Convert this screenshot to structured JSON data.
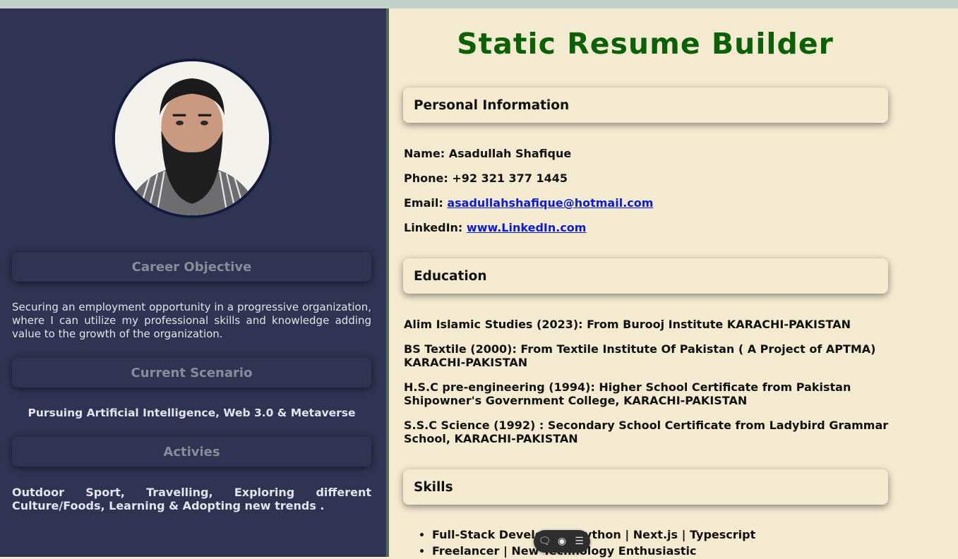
{
  "sidebar": {
    "career_heading": "Career Objective",
    "career_text": "Securing an employment opportunity in a progressive organization, where I can utilize my professional skills and knowledge adding value to the growth of the organization.",
    "scenario_heading": "Current Scenario",
    "scenario_text": "Pursuing Artificial Intelligence, Web 3.0 & Metaverse",
    "activities_heading": "Activies",
    "activities_text": "Outdoor Sport, Travelling, Exploring different Culture/Foods, Learning & Adopting new trends ."
  },
  "main": {
    "title": "Static Resume Builder",
    "personal": {
      "heading": "Personal Information",
      "name_label": "Name:",
      "name_value": "Asadullah Shafique",
      "phone_label": "Phone:",
      "phone_value": "+92 321 377 1445",
      "email_label": "Email:",
      "email_value": "asadullahshafique@hotmail.com",
      "linkedin_label": "LinkedIn:",
      "linkedin_value": "www.LinkedIn.com"
    },
    "education": {
      "heading": "Education",
      "items": [
        "Alim Islamic Studies (2023): From Burooj Institute KARACHI-PAKISTAN",
        "BS Textile (2000): From Textile Institute Of Pakistan ( A Project of APTMA) KARACHI-PAKISTAN",
        "H.S.C pre-engineering (1994): Higher School Certificate from Pakistan Shipowner's Government College, KARACHI-PAKISTAN",
        "S.S.C Science (1992) : Secondary School Certificate from Ladybird Grammar School, KARACHI-PAKISTAN"
      ]
    },
    "skills": {
      "heading": "Skills",
      "items": [
        "Full-Stack Developer | Python | Next.js | Typescript",
        "Freelancer | New Technology Enthusiastic"
      ]
    }
  },
  "toolbar": {
    "icons": [
      "comment-icon",
      "eye-icon",
      "menu-icon"
    ]
  },
  "colors": {
    "sidebar_bg": "#2f3452",
    "content_bg": "#f4ead0",
    "title_green": "#0c6108",
    "link_blue": "#0a1bd8"
  }
}
